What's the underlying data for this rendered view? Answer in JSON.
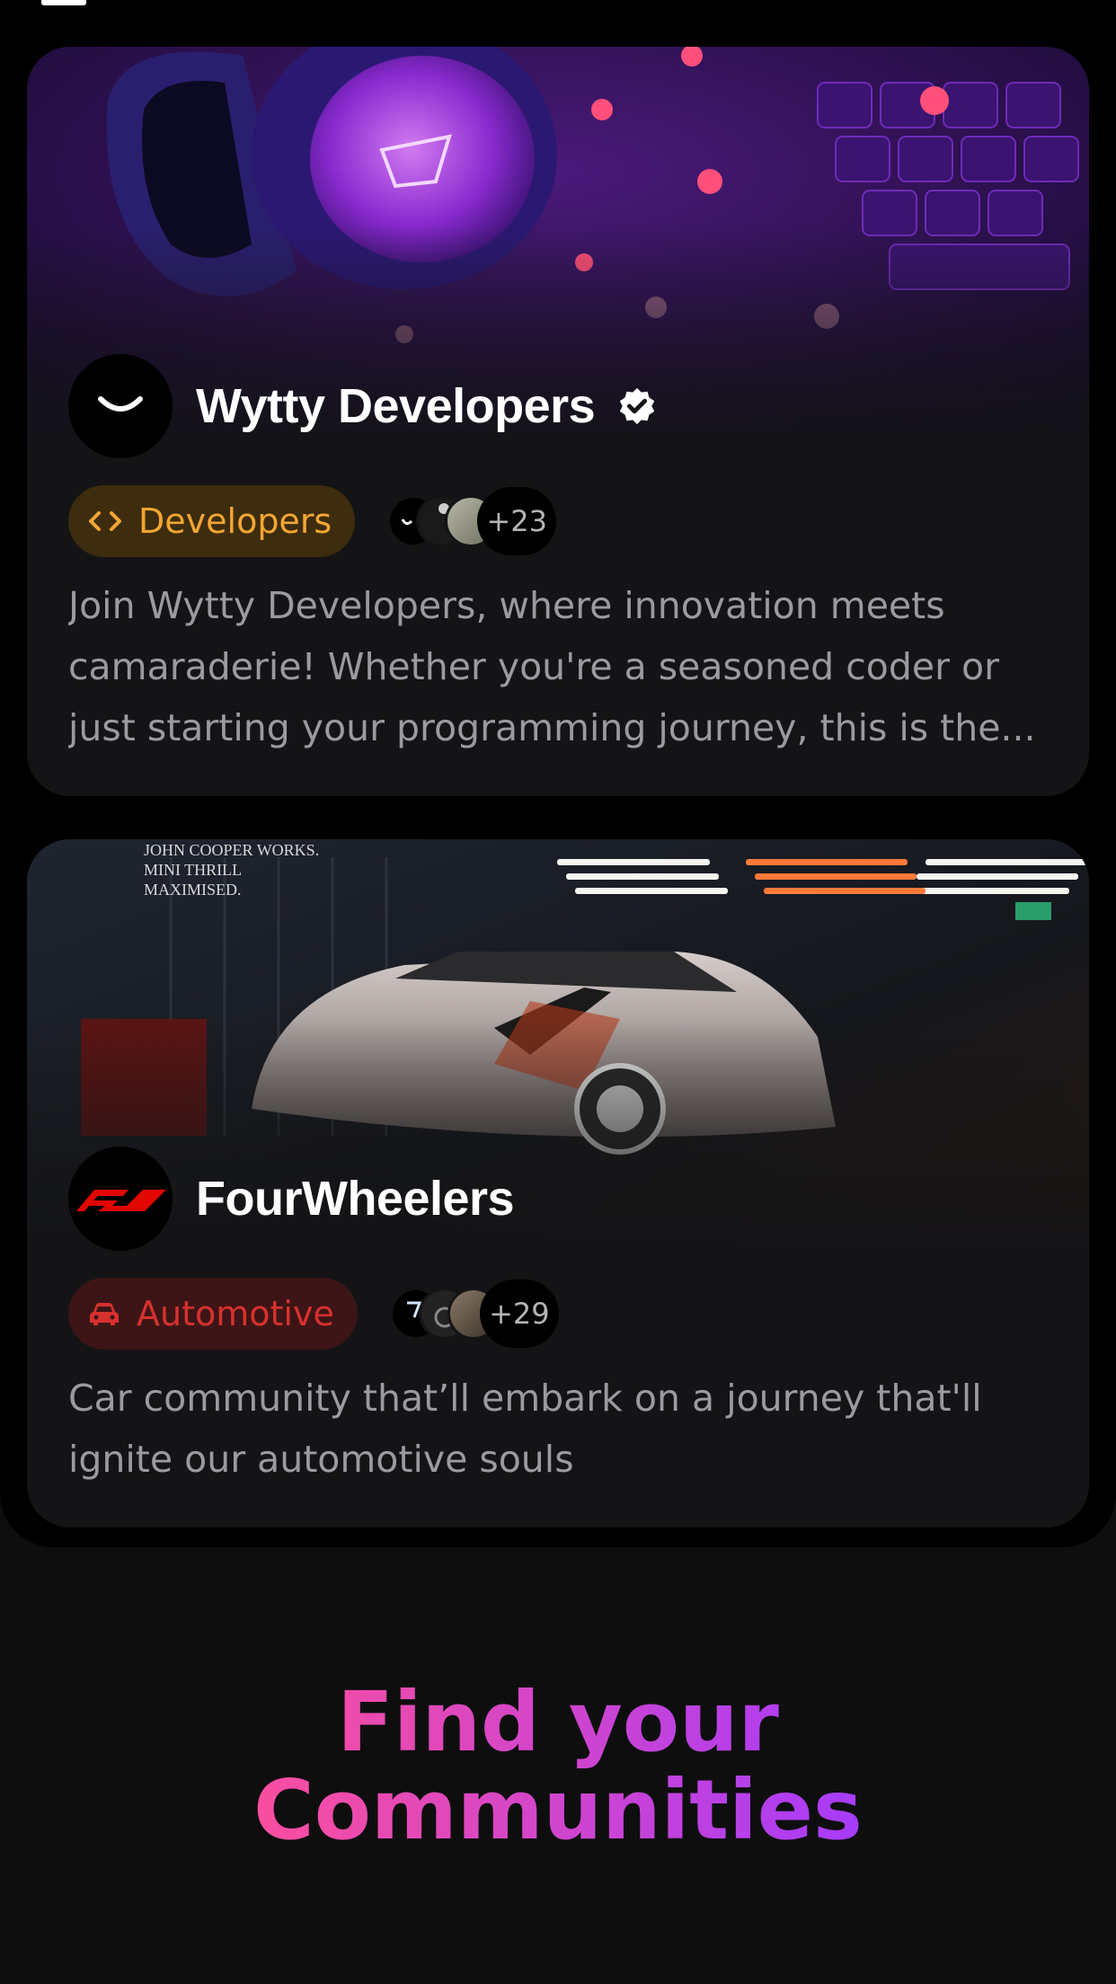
{
  "communities": [
    {
      "name": "Wytty Developers",
      "verified": true,
      "category": "Developers",
      "category_icon": "code-icon",
      "category_color": "#f3a633",
      "member_overflow": "+23",
      "description": "Join Wytty Developers, where innovation meets camaraderie! Whether you're a seasoned coder or just starting your programming journey, this is the..."
    },
    {
      "name": "FourWheelers",
      "verified": false,
      "category": "Automotive",
      "category_icon": "car-icon",
      "category_color": "#d6312e",
      "member_overflow": "+29",
      "description": "Car community that’ll embark on a journey that'll ignite our automotive souls"
    }
  ],
  "tagline": {
    "line1": "Find your",
    "line2": "Communities"
  }
}
